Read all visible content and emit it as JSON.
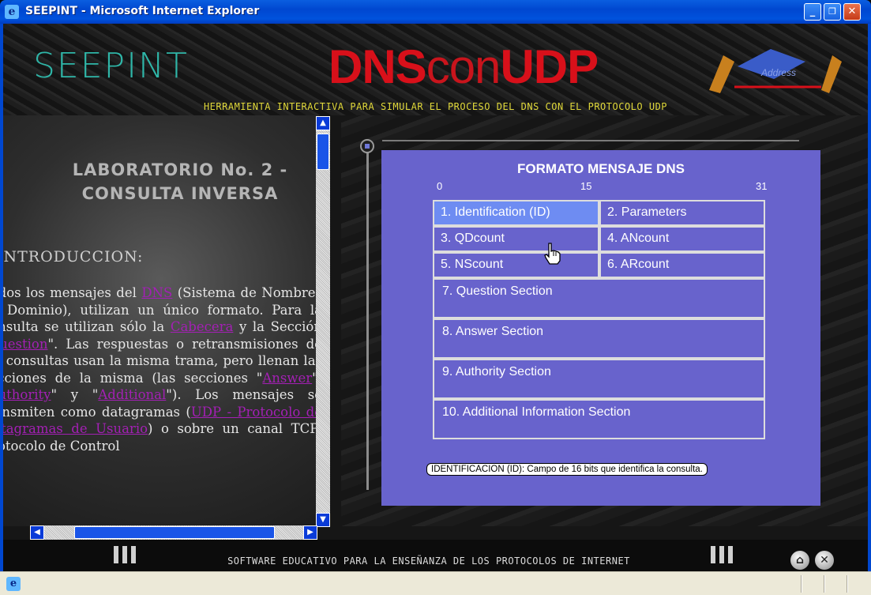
{
  "window": {
    "title": "SEEPINT - Microsoft Internet Explorer",
    "minimize": "_",
    "restore": "❐",
    "close": "✕"
  },
  "banner": {
    "logo_left": "SEEPINT",
    "logo_dns_1": "DNS",
    "logo_con": "con",
    "logo_dns_2": "UDP",
    "logo_right": "Address",
    "subtitle": "HERRAMIENTA INTERACTIVA PARA SIMULAR EL PROCESO DEL DNS CON EL PROTOCOLO UDP"
  },
  "left_panel": {
    "title_line1": "LABORATORIO No. 2 -",
    "title_line2": "CONSULTA INVERSA",
    "intro_heading": "INTRODUCCION:",
    "para_1a": "Todos los mensajes del ",
    "link_dns": "DNS",
    "para_1b": " (Sistema de Nombres de Dominio), utilizan un único formato. Para la consulta se utilizan sólo la ",
    "link_cabecera": "Cabecera",
    "para_1c": " y la Sección \"",
    "link_question": "Question",
    "para_1d": "\". Las respuestas o retransmisiones de las consultas usan la misma trama, pero llenan las secciones de la misma (las secciones \"",
    "link_answer": "Answer",
    "para_1e": "\", \"",
    "link_authority": "Authority",
    "para_1f": "\" y \"",
    "link_additional": "Additional",
    "para_1g": "\"). Los mensajes se transmiten como datagramas (",
    "link_udp": "UDP - Protocolo de Datagramas de Usuario",
    "para_1h": ") o sobre un canal TCP- Protocolo de Control"
  },
  "dns_panel": {
    "title": "FORMATO MENSAJE DNS",
    "bit_0": "0",
    "bit_15": "15",
    "bit_31": "31",
    "fields": {
      "f1": "1. Identification (ID)",
      "f2": "2. Parameters",
      "f3": "3. QDcount",
      "f4": "4. ANcount",
      "f5": "5. NScount",
      "f6": "6. ARcount",
      "f7": "7.  Question Section",
      "f8": "8.  Answer Section",
      "f9": "9.  Authority Section",
      "f10": "10. Additional Information Section"
    },
    "selected_field": "f1",
    "tooltip": "IDENTIFICACION (ID): Campo de 16 bits que identifica la consulta."
  },
  "footer": {
    "text": "SOFTWARE EDUCATIVO PARA LA ENSEÑANZA DE LOS PROTOCOLOS DE INTERNET",
    "home_icon": "⌂",
    "exit_icon": "✕"
  },
  "colors": {
    "panel_bg": "#6863cc",
    "selected_cell": "#6e8cf2",
    "link": "#a320b4",
    "logo_red": "#d8101a",
    "subtitle_yellow": "#e0d83a"
  }
}
